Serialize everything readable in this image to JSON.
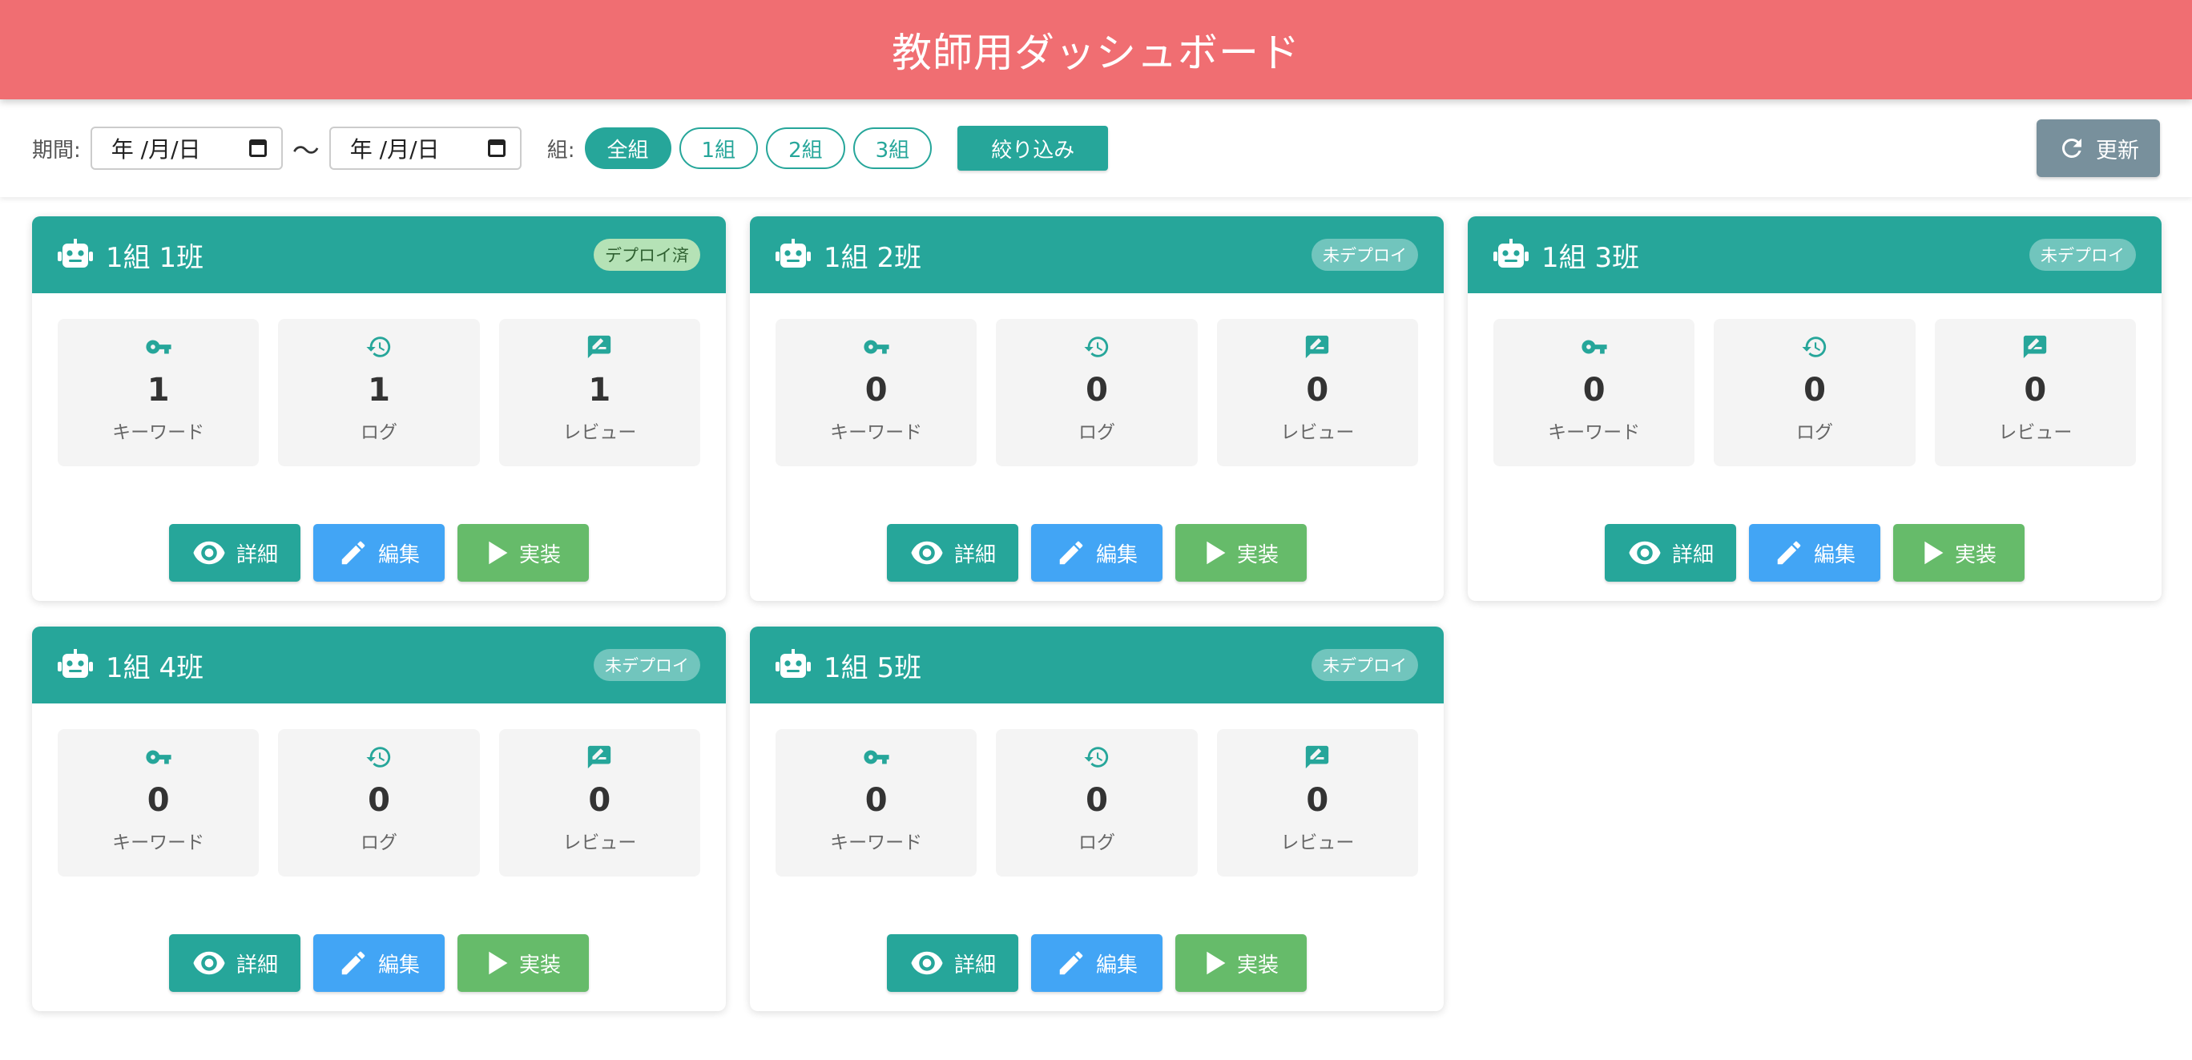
{
  "header": {
    "title": "教師用ダッシュボード"
  },
  "filters": {
    "period_label": "期間:",
    "date_from": "年 /月/日",
    "date_to": "年 /月/日",
    "range_sep": "〜",
    "group_label": "組:",
    "groups": [
      {
        "label": "全組",
        "active": true
      },
      {
        "label": "1組",
        "active": false
      },
      {
        "label": "2組",
        "active": false
      },
      {
        "label": "3組",
        "active": false
      }
    ],
    "apply_label": "絞り込み",
    "refresh_label": "更新"
  },
  "labels": {
    "keyword": "キーワード",
    "log": "ログ",
    "review": "レビュー",
    "detail": "詳細",
    "edit": "編集",
    "run": "実装"
  },
  "cards": [
    {
      "title": "1組 1班",
      "status": "デプロイ済",
      "deployed": true,
      "keyword": "1",
      "log": "1",
      "review": "1"
    },
    {
      "title": "1組 2班",
      "status": "未デプロイ",
      "deployed": false,
      "keyword": "0",
      "log": "0",
      "review": "0"
    },
    {
      "title": "1組 3班",
      "status": "未デプロイ",
      "deployed": false,
      "keyword": "0",
      "log": "0",
      "review": "0"
    },
    {
      "title": "1組 4班",
      "status": "未デプロイ",
      "deployed": false,
      "keyword": "0",
      "log": "0",
      "review": "0"
    },
    {
      "title": "1組 5班",
      "status": "未デプロイ",
      "deployed": false,
      "keyword": "0",
      "log": "0",
      "review": "0"
    }
  ],
  "colors": {
    "header": "#f06e72",
    "primary": "#26a69a",
    "edit": "#42a5f5",
    "run": "#66bb6a",
    "refresh": "#78909c"
  }
}
